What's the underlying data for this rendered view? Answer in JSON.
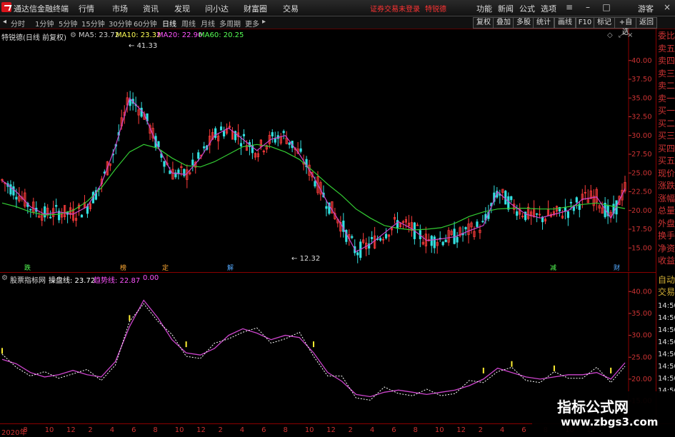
{
  "app": {
    "title": "通达信金融终端",
    "menu": [
      "行情",
      "市场",
      "资讯",
      "发现",
      "问小达",
      "财富圈",
      "交易"
    ],
    "login_notice": "证券交易未登录",
    "stock_link": "特锐德",
    "right_menu": [
      "功能",
      "新闻",
      "公式",
      "选项"
    ],
    "user": "游客",
    "window_controls": [
      "minimize-icon",
      "maximize-icon",
      "close-icon"
    ]
  },
  "periods": {
    "items": [
      "分时",
      "1分钟",
      "5分钟",
      "15分钟",
      "30分钟",
      "60分钟",
      "日线",
      "周线",
      "月线",
      "多周期",
      "更多"
    ],
    "active": "日线",
    "right_buttons": [
      "复权",
      "叠加",
      "多股",
      "统计",
      "画线",
      "F10",
      "标记",
      "+自选",
      "返回"
    ]
  },
  "main_chart": {
    "stock_title": "特锐德(日线 前复权)",
    "indicators": [
      {
        "label": "MA5: 23.72",
        "color": "#ffffff"
      },
      {
        "label": "MA10: 23.32",
        "color": "#ffff55"
      },
      {
        "label": "MA20: 22.90",
        "color": "#ff55ff"
      },
      {
        "label": "MA60: 20.25",
        "color": "#55ff55"
      }
    ],
    "high_label": "41.33",
    "low_label": "12.32",
    "y_ticks": [
      "40.00",
      "37.50",
      "35.00",
      "32.50",
      "30.00",
      "27.50",
      "25.00",
      "22.50",
      "20.00",
      "17.50",
      "15.00"
    ],
    "y_top_marks": [
      "R",
      "30"
    ],
    "event_tags": [
      "跌",
      "榜",
      "定",
      "解",
      "减",
      "财"
    ]
  },
  "chart_data": {
    "type": "line",
    "title": "特锐德(日线 前复权)",
    "ylim": [
      13.5,
      41.5
    ],
    "high": 41.33,
    "low": 12.32,
    "series": [
      {
        "name": "MA60",
        "values": [
          21.0,
          20.5,
          19.8,
          19.4,
          19.5,
          20.0,
          21.2,
          23.0,
          25.5,
          27.8,
          28.8,
          28.3,
          27.0,
          26.0,
          25.8,
          26.5,
          27.5,
          28.5,
          28.8,
          28.5,
          27.8,
          26.8,
          25.2,
          23.5,
          22.0,
          20.2,
          19.0,
          18.0,
          17.6,
          17.4,
          17.5,
          17.7,
          18.3,
          19.2,
          19.8,
          20.2,
          20.3,
          20.3,
          20.2,
          20.2,
          20.5,
          20.8,
          21.0,
          20.6,
          20.25
        ]
      },
      {
        "name": "MA20",
        "values": [
          24.0,
          22.5,
          20.5,
          19.5,
          19.8,
          19.5,
          20.5,
          23.5,
          28.5,
          35.0,
          33.0,
          28.5,
          25.0,
          24.8,
          27.0,
          30.0,
          31.0,
          29.5,
          28.0,
          29.5,
          30.0,
          27.5,
          24.5,
          21.0,
          18.0,
          14.5,
          15.5,
          17.0,
          18.5,
          17.5,
          16.0,
          16.2,
          16.5,
          17.3,
          18.0,
          22.5,
          20.8,
          19.5,
          19.0,
          19.5,
          20.0,
          21.5,
          21.8,
          19.0,
          22.9
        ]
      }
    ],
    "sub_series": {
      "name": "操盘线",
      "value_label": "23.72",
      "trend_label": "趋势线",
      "trend_value": "22.87",
      "extra_value": "0.00",
      "y_ticks": [
        "40.00",
        "35.00",
        "30.00",
        "25.00",
        "20.00",
        "15.00"
      ],
      "ylim": [
        12,
        42
      ],
      "values": [
        24.5,
        23.5,
        21.5,
        20.5,
        21.0,
        22.0,
        21.0,
        20.5,
        24.0,
        32.0,
        38.0,
        34.0,
        29.0,
        26.0,
        25.5,
        27.0,
        30.0,
        31.5,
        30.5,
        29.0,
        30.0,
        29.5,
        26.0,
        21.5,
        19.5,
        16.5,
        16.0,
        17.0,
        17.5,
        17.0,
        16.5,
        17.0,
        17.5,
        18.5,
        20.0,
        22.5,
        21.5,
        20.5,
        20.0,
        20.5,
        21.0,
        21.0,
        21.5,
        20.0,
        23.72
      ]
    }
  },
  "sub_chart": {
    "title": "股票指标网",
    "line_label": "操盘线: 23.72",
    "trend_label": "趋势线: 22.87",
    "extra": "0.00"
  },
  "side_panel": {
    "items": [
      "委比",
      "卖五",
      "卖四",
      "卖三",
      "卖二",
      "卖一",
      "买一",
      "买二",
      "买三",
      "买四",
      "买五",
      "现价",
      "涨跌",
      "涨幅",
      "总量",
      "外盘",
      "换手",
      "净资",
      "收益"
    ],
    "yellow_items": [
      "自动",
      "交易"
    ],
    "times": [
      "14:50",
      "14:50",
      "14:50",
      "14:50",
      "14:50",
      "14:50",
      "14:50",
      "14:50"
    ]
  },
  "date_axis": {
    "labels": [
      "2020年",
      "8",
      "10",
      "12",
      "2",
      "4",
      "6",
      "8",
      "10",
      "12",
      "2",
      "4",
      "6",
      "8",
      "10",
      "12",
      "2",
      "4",
      "6",
      "8",
      "10",
      "12",
      "2",
      "4",
      "6",
      "8",
      "10",
      "12",
      "2"
    ]
  },
  "watermark": {
    "title": "指标公式网",
    "url": "www.zbgs3.com"
  }
}
